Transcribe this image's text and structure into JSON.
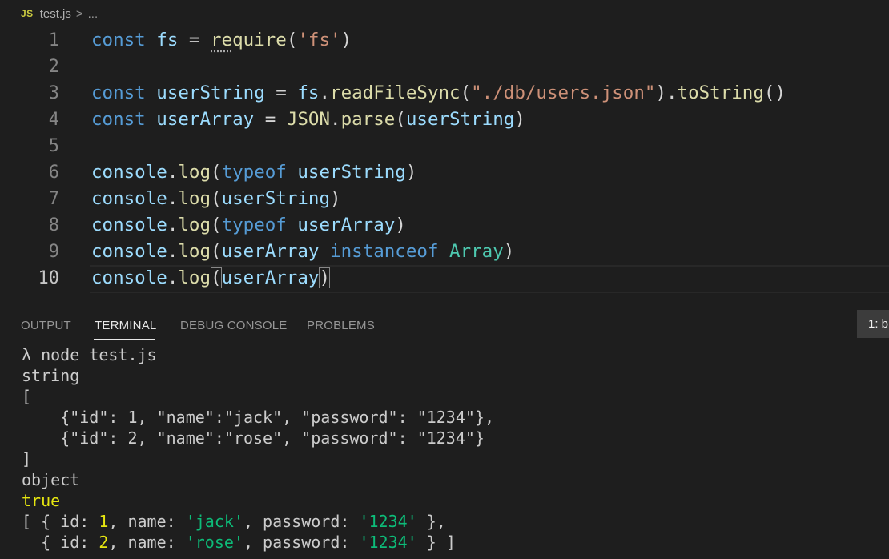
{
  "breadcrumb": {
    "icon": "JS",
    "file": "test.js",
    "separator": ">",
    "more": "..."
  },
  "editor": {
    "active_line": 10,
    "lines": [
      {
        "number": "1",
        "text": "const fs = require('fs')"
      },
      {
        "number": "2",
        "text": ""
      },
      {
        "number": "3",
        "text": "const userString = fs.readFileSync(\"./db/users.json\").toString()"
      },
      {
        "number": "4",
        "text": "const userArray = JSON.parse(userString)"
      },
      {
        "number": "5",
        "text": ""
      },
      {
        "number": "6",
        "text": "console.log(typeof userString)"
      },
      {
        "number": "7",
        "text": "console.log(userString)"
      },
      {
        "number": "8",
        "text": "console.log(typeof userArray)"
      },
      {
        "number": "9",
        "text": "console.log(userArray instanceof Array)"
      },
      {
        "number": "10",
        "text": "console.log(userArray)"
      }
    ]
  },
  "panel": {
    "tabs": [
      {
        "label": "OUTPUT",
        "active": false
      },
      {
        "label": "TERMINAL",
        "active": true
      },
      {
        "label": "DEBUG CONSOLE",
        "active": false
      },
      {
        "label": "PROBLEMS",
        "active": false
      }
    ],
    "terminal_selector": "1: b"
  },
  "terminal": {
    "lines": [
      "λ node test.js",
      "string",
      "[",
      "    {\"id\": 1, \"name\":\"jack\", \"password\": \"1234\"},",
      "    {\"id\": 2, \"name\":\"rose\", \"password\": \"1234\"}",
      "]",
      "object",
      "true",
      "[ { id: 1, name: 'jack', password: '1234' },",
      "  { id: 2, name: 'rose', password: '1234' } ]"
    ]
  },
  "colors": {
    "background": "#1e1e1e",
    "keyword": "#569cd6",
    "variable": "#9cdcfe",
    "function": "#dcdcaa",
    "string": "#ce9178",
    "type": "#4ec9b0",
    "terminal_yellow": "#e5e510",
    "terminal_green": "#0dbc79"
  }
}
